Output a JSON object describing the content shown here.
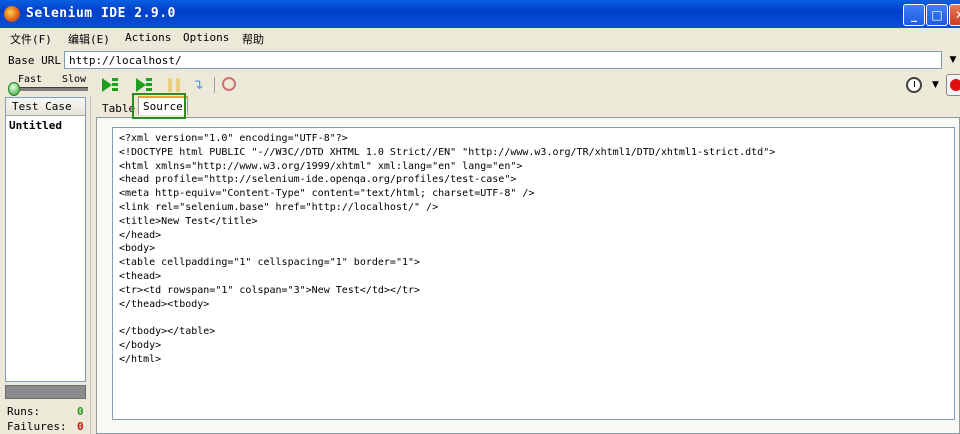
{
  "window": {
    "title": "Selenium IDE 2.9.0"
  },
  "menu": [
    {
      "label": "文件(F)"
    },
    {
      "label": "编辑(E)"
    },
    {
      "label": "Actions"
    },
    {
      "label": "Options"
    },
    {
      "label": "帮助"
    }
  ],
  "base_url": {
    "label": "Base URL",
    "value": "http://localhost/"
  },
  "speed": {
    "fast_label": "Fast",
    "slow_label": "Slow"
  },
  "toolbar_icons": [
    "play-suite-icon",
    "play-test-icon",
    "pause-icon",
    "step-icon",
    "rollup-icon",
    "schedule-clock-icon",
    "record-icon"
  ],
  "test_case_panel": {
    "header": "Test Case",
    "items": [
      "Untitled"
    ]
  },
  "stats": {
    "runs_label": "Runs:",
    "runs_value": "0",
    "failures_label": "Failures:",
    "failures_value": "0"
  },
  "tabs": [
    {
      "label": "Table"
    },
    {
      "label": "Source",
      "active": true
    }
  ],
  "source_lines": [
    "<?xml version=\"1.0\" encoding=\"UTF-8\"?>",
    "<!DOCTYPE html PUBLIC \"-//W3C//DTD XHTML 1.0 Strict//EN\" \"http://www.w3.org/TR/xhtml1/DTD/xhtml1-strict.dtd\">",
    "<html xmlns=\"http://www.w3.org/1999/xhtml\" xml:lang=\"en\" lang=\"en\">",
    "<head profile=\"http://selenium-ide.openqa.org/profiles/test-case\">",
    "<meta http-equiv=\"Content-Type\" content=\"text/html; charset=UTF-8\" />",
    "<link rel=\"selenium.base\" href=\"http://localhost/\" />",
    "<title>New Test</title>",
    "</head>",
    "<body>",
    "<table cellpadding=\"1\" cellspacing=\"1\" border=\"1\">",
    "<thead>",
    "<tr><td rowspan=\"1\" colspan=\"3\">New Test</td></tr>",
    "</thead><tbody>",
    "",
    "</tbody></table>",
    "</body>",
    "</html>"
  ],
  "colors": {
    "titlebar": "#0a50d8",
    "highlight": "#2e8b20",
    "runs": "#2a9a20",
    "failures": "#d01010",
    "play": "#1aa01a"
  }
}
